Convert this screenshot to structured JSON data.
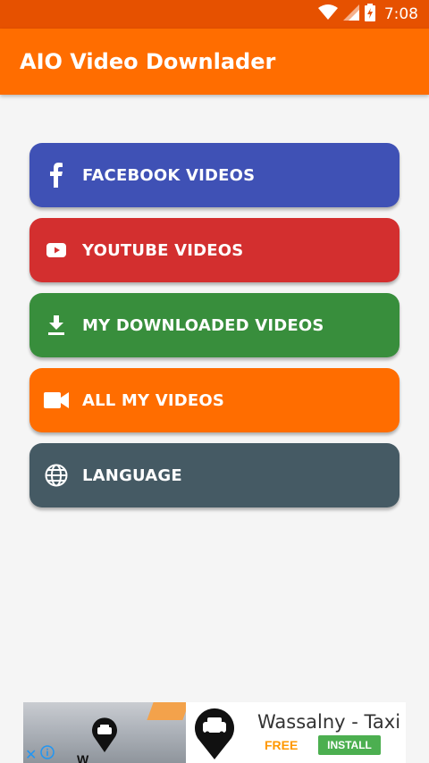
{
  "status_bar": {
    "time": "7:08"
  },
  "app_bar": {
    "title": "AIO Video Downlader"
  },
  "menu": [
    {
      "id": "facebook",
      "label": "FACEBOOK VIDEOS",
      "icon": "facebook-icon",
      "color": "#3f51b5"
    },
    {
      "id": "youtube",
      "label": "YOUTUBE VIDEOS",
      "icon": "youtube-icon",
      "color": "#d32f2f"
    },
    {
      "id": "downloaded",
      "label": "MY DOWNLOADED VIDEOS",
      "icon": "download-icon",
      "color": "#388e3c"
    },
    {
      "id": "all",
      "label": "ALL MY VIDEOS",
      "icon": "video-camera-icon",
      "color": "#ff6d00"
    },
    {
      "id": "language",
      "label": "LANGUAGE",
      "icon": "globe-icon",
      "color": "#455a64"
    }
  ],
  "ad": {
    "app_name": "Wassalny - Taxi",
    "price": "FREE",
    "install_label": "INSTALL",
    "cut_text": "W"
  },
  "colors": {
    "status_bar": "#e65100",
    "app_bar": "#ff6d00",
    "background": "#f5f5f5"
  }
}
